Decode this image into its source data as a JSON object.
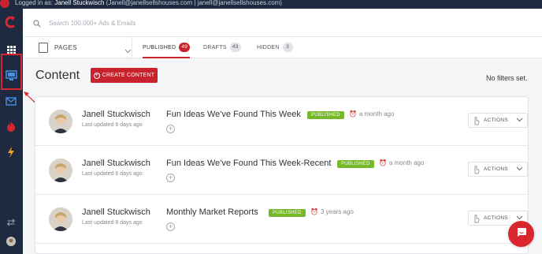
{
  "topbar": {
    "logged_in_label": "Logged in as:",
    "user_name": "Janell Stuckwisch",
    "user_email": "(Janell@janellsellshouses.com | janell@janellsellshouses.com)"
  },
  "sidebar": {
    "items": [
      {
        "icon": "logo-icon"
      },
      {
        "icon": "grid-icon"
      },
      {
        "icon": "pages-icon"
      },
      {
        "icon": "mail-icon"
      },
      {
        "icon": "fire-icon"
      },
      {
        "icon": "bolt-icon"
      },
      {
        "icon": "swap-icon"
      },
      {
        "icon": "avatar-icon"
      }
    ],
    "highlight_color": "#d9262e"
  },
  "search": {
    "placeholder": "Search 100,000+ Ads & Emails"
  },
  "tabbar": {
    "selector_label": "PAGES",
    "tabs": [
      {
        "label": "PUBLISHED",
        "count": "49",
        "active": true
      },
      {
        "label": "DRAFTS",
        "count": "43",
        "active": false
      },
      {
        "label": "HIDDEN",
        "count": "3",
        "active": false
      }
    ]
  },
  "main": {
    "title": "Content",
    "create_button": "CREATE CONTENT",
    "filters_text": "No filters set."
  },
  "posts": [
    {
      "author": "Janell Stuckwisch",
      "updated": "Last updated 6 days ago",
      "title": "Fun Ideas We've Found This Week",
      "status": "PUBLISHED",
      "time": "a month ago",
      "actions": "ACTIONS"
    },
    {
      "author": "Janell Stuckwisch",
      "updated": "Last updated 6 days ago",
      "title": "Fun Ideas We've Found This Week-Recent",
      "status": "PUBLISHED",
      "time": "a month ago",
      "actions": "ACTIONS"
    },
    {
      "author": "Janell Stuckwisch",
      "updated": "Last updated 8 days ago",
      "title": "Monthly Market Reports",
      "status": "PUBLISHED",
      "time": "3 years ago",
      "actions": "ACTIONS"
    }
  ],
  "colors": {
    "brand_red": "#c8232c",
    "sidebar_bg": "#1d2a3f",
    "published_green": "#76b82a"
  }
}
